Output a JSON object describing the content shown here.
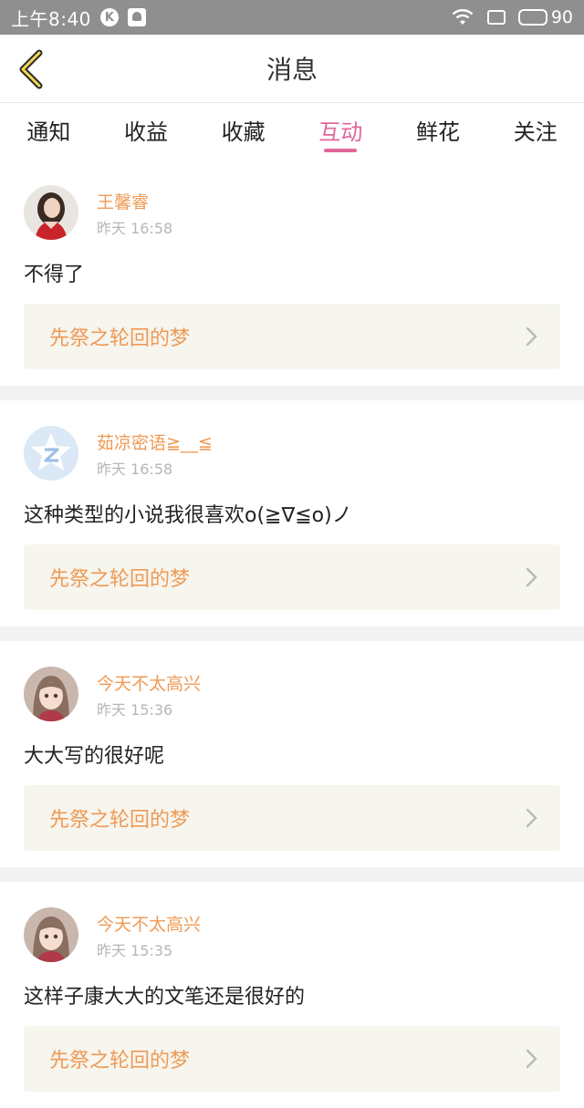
{
  "status_bar": {
    "time": "上午8:40",
    "k_label": "K",
    "battery": "90"
  },
  "header": {
    "title": "消息"
  },
  "tabs": [
    {
      "label": "通知"
    },
    {
      "label": "收益"
    },
    {
      "label": "收藏"
    },
    {
      "label": "互动"
    },
    {
      "label": "鲜花"
    },
    {
      "label": "关注"
    }
  ],
  "active_tab": "互动",
  "colors": {
    "accent_pink": "#e2669c",
    "name_orange": "#ef9a55",
    "status_bar": "#8f8f8f"
  },
  "messages": [
    {
      "username": "王馨睿",
      "time": "昨天 16:58",
      "comment": "不得了",
      "book_title": "先祭之轮回的梦",
      "avatar_icon": "photo-avatar"
    },
    {
      "username": "茹凉密语≧__≦",
      "time": "昨天 16:58",
      "comment": "这种类型的小说我很喜欢o(≧∇≦o)ノ",
      "book_title": "先祭之轮回的梦",
      "avatar_icon": "qzone-default-avatar"
    },
    {
      "username": "今天不太高兴",
      "time": "昨天 15:36",
      "comment": "大大写的很好呢",
      "book_title": "先祭之轮回的梦",
      "avatar_icon": "anime-girl-avatar"
    },
    {
      "username": "今天不太高兴",
      "time": "昨天 15:35",
      "comment": "这样子康大大的文笔还是很好的",
      "book_title": "先祭之轮回的梦",
      "avatar_icon": "anime-girl-avatar"
    }
  ]
}
